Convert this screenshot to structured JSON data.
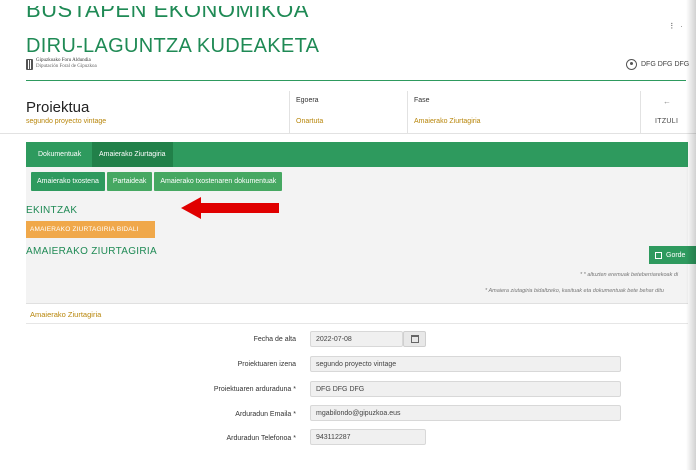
{
  "header": {
    "title_line1": "BUSTAPEN EKONOMIKOA",
    "title_line2": "DIRU-LAGUNTZA KUDEAKETA",
    "logo_line1": "Gipuzkoako Foru Aldundia",
    "logo_line2": "Diputación Foral de Gipuzkoa",
    "top_dots": "⠇ ·",
    "user_name": "DFG DFG DFG"
  },
  "project": {
    "title": "Proiektua",
    "subtitle": "segundo proyecto vintage",
    "status_label": "Egoera",
    "status_value": "Onartuta",
    "phase_label": "Fase",
    "phase_value": "Amaierako Ziurtagiria",
    "back_arrow": "←",
    "back_label": "ITZULI"
  },
  "tabs": [
    {
      "label": "Dokumentuak"
    },
    {
      "label": "Amaierako Ziurtagiria"
    }
  ],
  "subtabs": [
    {
      "label": "Amaierako txostena"
    },
    {
      "label": "Partaideak"
    },
    {
      "label": "Amaierako txostenaren dokumentuak"
    }
  ],
  "actions": {
    "section1_title": "EKINTZAK",
    "send_button": "AMAIERAKO ZIURTAGIRIA BIDALI",
    "section2_title": "AMAIERAKO ZIURTAGIRIA",
    "save_button": "Gorde"
  },
  "notes": {
    "required": "* * altuzten eremuak beteberriarekoak di",
    "instructions": "* Amaiera ziutagiria bidaltzeko, kasituak eta dokumentuak bete behar ditu"
  },
  "form": {
    "panel_title": "Amaierako Ziurtagiria",
    "rows": [
      {
        "label": "Fecha de alta",
        "value": "2022-07-08"
      },
      {
        "label": "Proiektuaren izena",
        "value": "segundo proyecto vintage"
      },
      {
        "label": "Proiektuaren arduraduna *",
        "value": "DFG DFG DFG"
      },
      {
        "label": "Arduradun Emaila *",
        "value": "mgabilondo@gipuzkoa.eus"
      },
      {
        "label": "Arduradun Telefonoa *",
        "value": "943112287"
      }
    ]
  },
  "colors": {
    "brand_green": "#1f8a55",
    "tab_green": "#2e9a5e",
    "accent_orange": "#f0a84a",
    "arrow_red": "#e00000"
  }
}
